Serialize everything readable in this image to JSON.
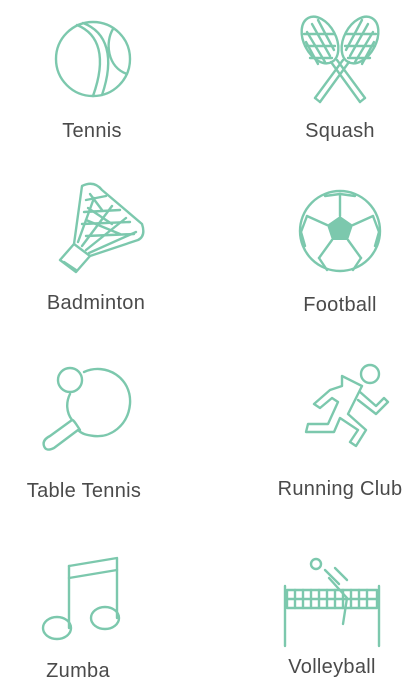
{
  "theme": {
    "accent": "#7cc8ad",
    "text": "#4a4a4a",
    "background": "#ffffff"
  },
  "activities": [
    {
      "label": "Tennis",
      "icon": "tennis-ball-icon"
    },
    {
      "label": "Squash",
      "icon": "squash-rackets-icon"
    },
    {
      "label": "Badminton",
      "icon": "shuttlecock-icon"
    },
    {
      "label": "Football",
      "icon": "soccer-ball-icon"
    },
    {
      "label": "Table Tennis",
      "icon": "ping-pong-paddle-icon"
    },
    {
      "label": "Running Club",
      "icon": "runner-icon"
    },
    {
      "label": "Zumba",
      "icon": "music-note-icon"
    },
    {
      "label": "Volleyball",
      "icon": "volleyball-net-icon"
    }
  ]
}
